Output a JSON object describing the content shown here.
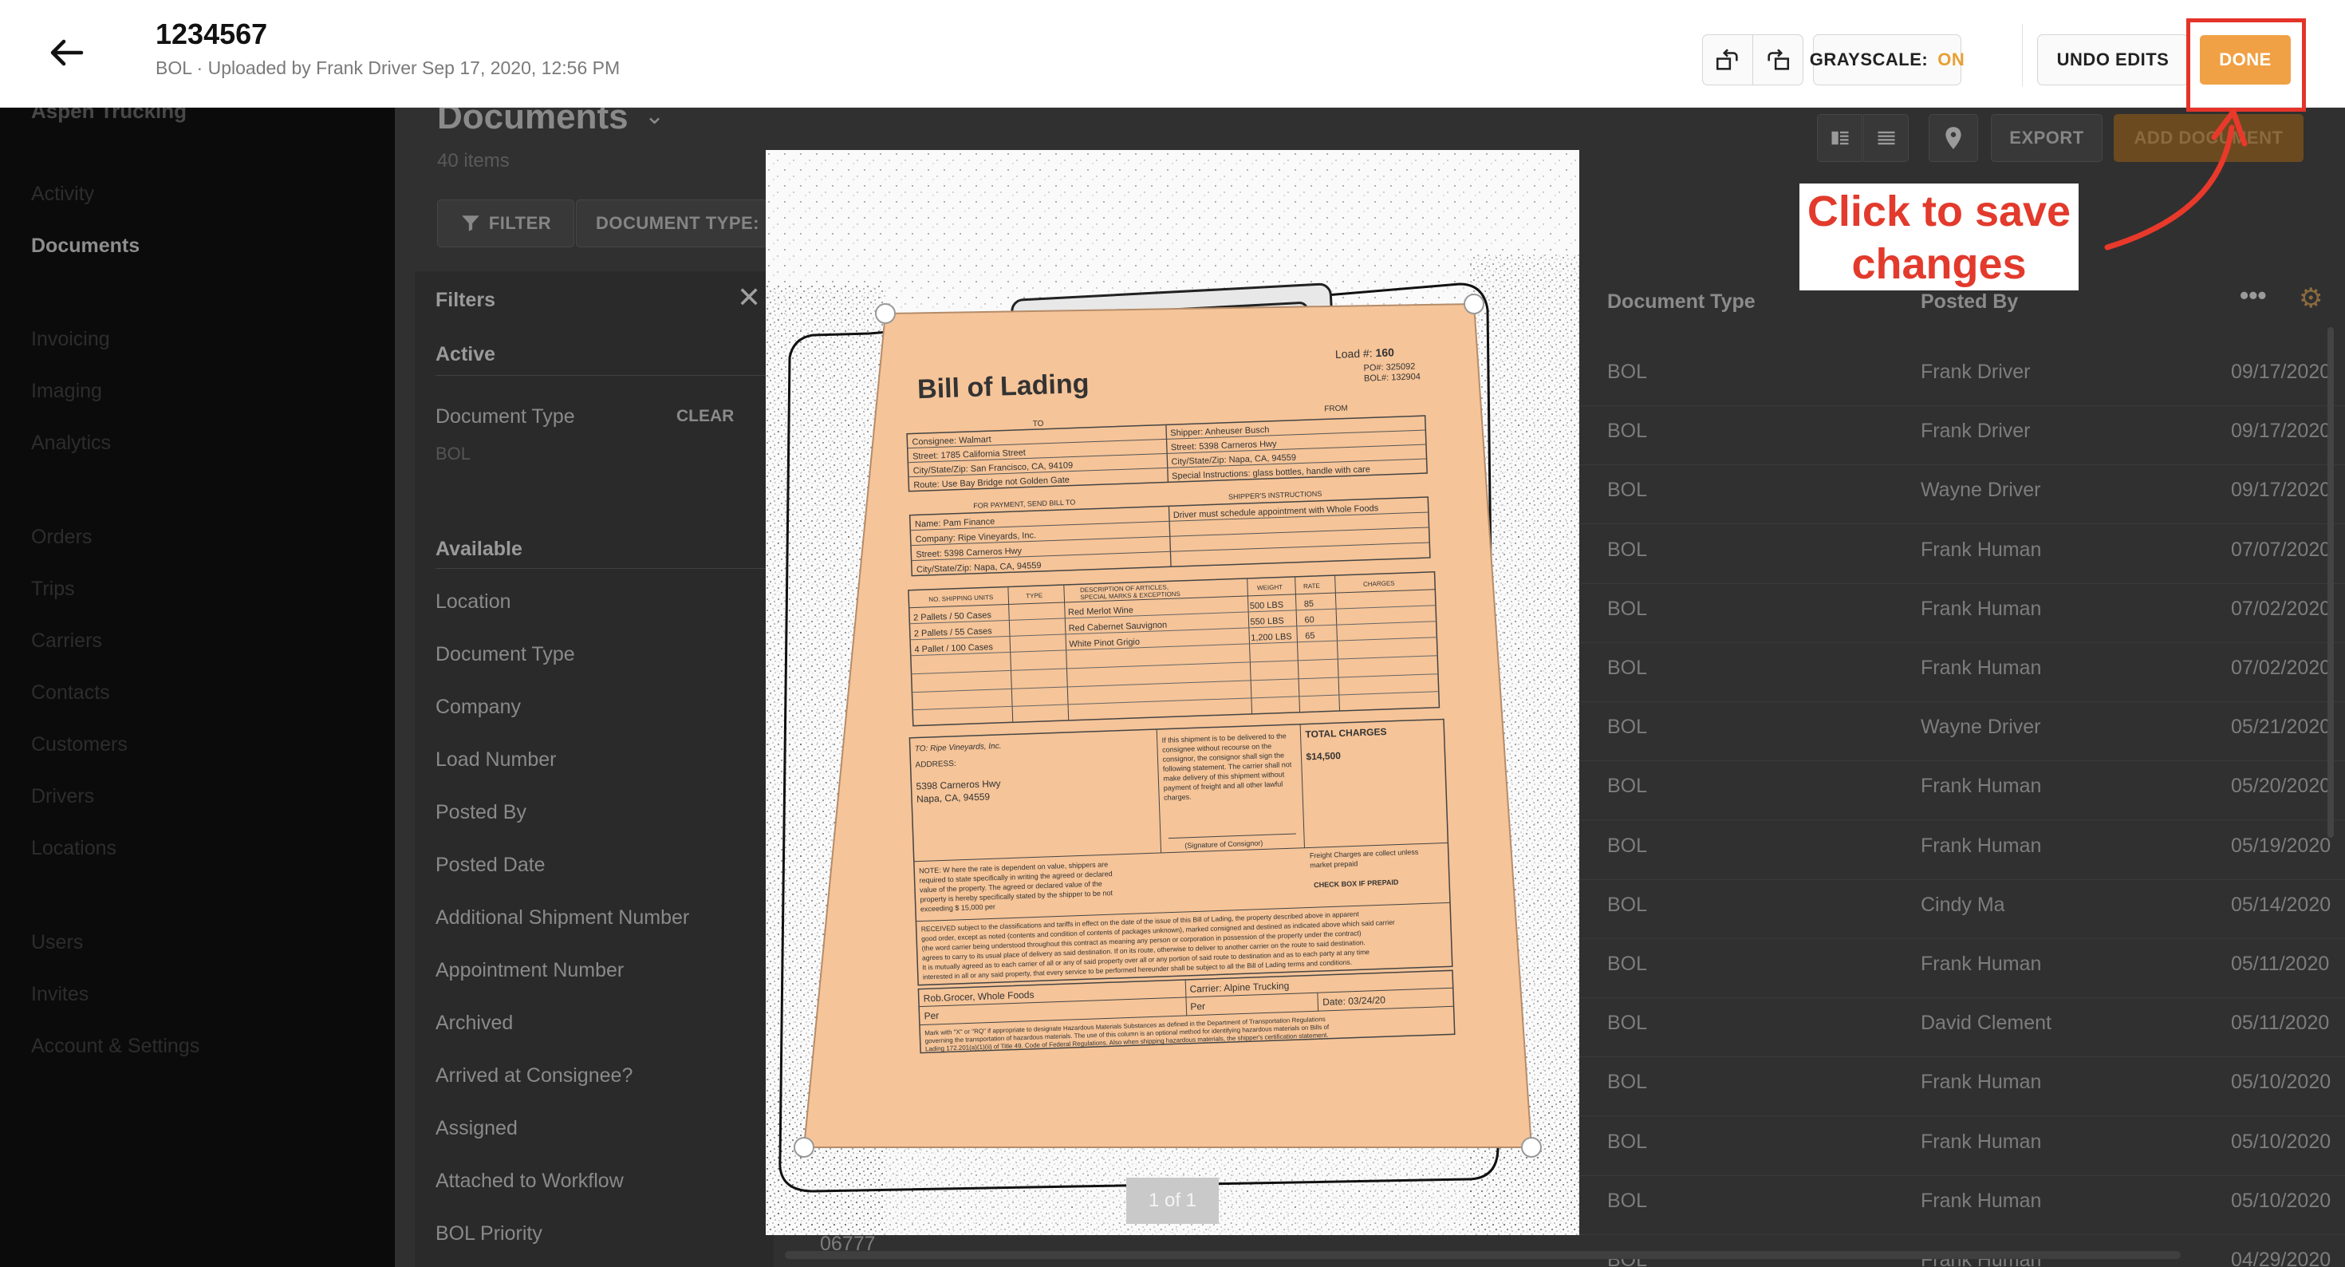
{
  "header": {
    "title": "1234567",
    "subtitle": "BOL · Uploaded by Frank Driver Sep 17, 2020, 12:56 PM",
    "grayscale_label": "GRAYSCALE:",
    "grayscale_state": "ON",
    "undo_label": "UNDO EDITS",
    "done_label": "DONE"
  },
  "annotation": {
    "line1": "Click to save",
    "line2": "changes",
    "color": "#e23a2c"
  },
  "sidebar": {
    "company": "Aspen Trucking",
    "items": [
      "Activity",
      "Documents",
      "Invoicing",
      "Imaging",
      "Analytics",
      "Orders",
      "Trips",
      "Carriers",
      "Contacts",
      "Customers",
      "Drivers",
      "Locations",
      "Users",
      "Invites",
      "Account & Settings"
    ],
    "active": "Documents"
  },
  "documents": {
    "title": "Documents",
    "count": "40 items",
    "filter_label": "FILTER",
    "doctype_label": "DOCUMENT TYPE:",
    "export_label": "EXPORT",
    "add_label": "ADD DOCUMENT"
  },
  "filters": {
    "title": "Filters",
    "active_heading": "Active",
    "active_field": "Document Type",
    "active_value": "BOL",
    "clear_label": "CLEAR",
    "available_heading": "Available",
    "available": [
      "Location",
      "Document Type",
      "Company",
      "Load Number",
      "Posted By",
      "Posted Date",
      "Additional Shipment Number",
      "Appointment Number",
      "Archived",
      "Arrived at Consignee?",
      "Assigned",
      "Attached to Workflow",
      "BOL Priority"
    ]
  },
  "table": {
    "columns": [
      "Document Type",
      "Posted By"
    ],
    "rows": [
      {
        "type": "BOL",
        "by": "Frank Driver",
        "date": "09/17/2020"
      },
      {
        "type": "BOL",
        "by": "Frank Driver",
        "date": "09/17/2020"
      },
      {
        "type": "BOL",
        "by": "Wayne Driver",
        "date": "09/17/2020"
      },
      {
        "type": "BOL",
        "by": "Frank Human",
        "date": "07/07/2020"
      },
      {
        "type": "BOL",
        "by": "Frank Human",
        "date": "07/02/2020"
      },
      {
        "type": "BOL",
        "by": "Frank Human",
        "date": "07/02/2020"
      },
      {
        "type": "BOL",
        "by": "Wayne Driver",
        "date": "05/21/2020"
      },
      {
        "type": "BOL",
        "by": "Frank Human",
        "date": "05/20/2020"
      },
      {
        "type": "BOL",
        "by": "Frank Human",
        "date": "05/19/2020"
      },
      {
        "type": "BOL",
        "by": "Cindy Ma",
        "date": "05/14/2020"
      },
      {
        "type": "BOL",
        "by": "Frank Human",
        "date": "05/11/2020"
      },
      {
        "type": "BOL",
        "by": "David Clement",
        "date": "05/11/2020"
      },
      {
        "type": "BOL",
        "by": "Frank Human",
        "date": "05/10/2020"
      },
      {
        "type": "BOL",
        "by": "Frank Human",
        "date": "05/10/2020"
      },
      {
        "type": "BOL",
        "by": "Frank Human",
        "date": "05/10/2020"
      },
      {
        "type": "BOL",
        "by": "Frank Human",
        "date": "04/29/2020"
      }
    ],
    "partial_row_number": "06777"
  },
  "viewer": {
    "page_indicator": "1 of 1",
    "crop_color": "#f5c498"
  },
  "bol": {
    "title": "Bill of Lading",
    "load_label": "Load #:",
    "load_no": "160",
    "po": "PO#: 325092",
    "bol_no": "BOL#: 132904",
    "to_label": "TO",
    "from_label": "FROM",
    "consignee": "Consignee: Walmart",
    "street": "Street: 1785 California Street",
    "city": "City/State/Zip: San Francisco, CA, 94109",
    "route": "Route: Use Bay Bridge not Golden Gate",
    "shipper": "Shipper: Anheuser Busch",
    "shipper_street": "Street: 5398 Carneros Hwy",
    "shipper_city": "City/State/Zip: Napa, CA, 94559",
    "special": "Special Instructions: glass bottles, handle with care",
    "pay_label": "FOR PAYMENT, SEND BILL TO",
    "instr_label": "SHIPPER'S INSTRUCTIONS",
    "instr": "Driver must schedule appointment with Whole Foods",
    "pay_name": "Name: Pam Finance",
    "pay_company": "Company: Ripe Vineyards, Inc.",
    "pay_street": "Street: 5398 Carneros Hwy",
    "pay_city": "City/State/Zip: Napa, CA, 94559",
    "col_units": "NO. SHIPPING UNITS",
    "col_type": "TYPE",
    "col_desc": "DESCRIPTION OF ARTICLES, SPECIAL MARKS & EXCEPTIONS",
    "col_weight": "WEIGHT",
    "col_rate": "RATE",
    "col_charges": "CHARGES",
    "items": [
      {
        "units": "2 Pallets / 50 Cases",
        "desc": "Red Merlot Wine",
        "weight": "500 LBS",
        "rate": "85"
      },
      {
        "units": "2 Pallets / 55 Cases",
        "desc": "Red Cabernet Sauvignon",
        "weight": "550 LBS",
        "rate": "60"
      },
      {
        "units": "4 Pallet / 100 Cases",
        "desc": "White Pinot Grigio",
        "weight": "1,200 LBS",
        "rate": "65"
      }
    ],
    "to_company": "TO: Ripe Vineyards, Inc.",
    "address_label": "ADDRESS:",
    "address1": "5398 Carneros Hwy",
    "address2": "Napa, CA, 94559",
    "total_label": "TOTAL CHARGES",
    "total": "$14,500",
    "signature_label": "(Signature of Consignor)",
    "freight_note": "Freight Charges are collect unless market prepaid",
    "prepaid": "CHECK BOX IF PREPAID",
    "received_text": "RECEIVED subject to the classifications and tariffs in effect on the date of the issue of this Bill of Lading",
    "signee": "Rob.Grocer, Whole Foods",
    "carrier": "Carrier: Alpine Trucking",
    "per": "Per",
    "date": "Date: 03/24/20",
    "hazmat_text": "Mark with \"X\" or \"RQ\" if appropriate to designate Hazardous Materials Substances as defined in the Department of Transportation Regulations"
  }
}
